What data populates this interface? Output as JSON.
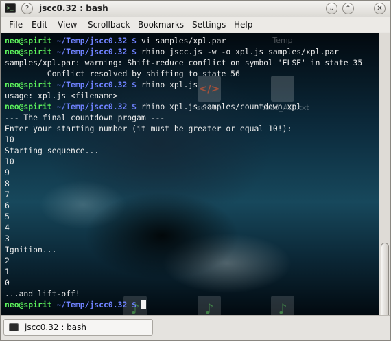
{
  "window": {
    "title": "jscc0.32 : bash",
    "buttons": {
      "help": "?",
      "minimize": "⌄",
      "maximize": "⌃",
      "close": "✕"
    },
    "app_icon": "terminal-icon"
  },
  "menu": [
    "File",
    "Edit",
    "View",
    "Scrollback",
    "Bookmarks",
    "Settings",
    "Help"
  ],
  "desktop_icons": [
    {
      "label": "Temp",
      "icon": "folder-icon"
    },
    {
      "label": "screen",
      "icon": "html-file-icon"
    },
    {
      "label": "todo_ALL.txt",
      "icon": "text-file-icon"
    }
  ],
  "prompt": {
    "user": "neo@spirit",
    "path": "~/Temp/jscc0.32",
    "symbol": "$"
  },
  "terminal_lines": [
    {
      "type": "prompt",
      "cmd": " vi samples/xpl.par"
    },
    {
      "type": "prompt",
      "cmd": " rhino jscc.js -w -o xpl.js samples/xpl.par"
    },
    {
      "type": "out",
      "text": "samples/xpl.par: warning: Shift-reduce conflict on symbol 'ELSE' in state 35"
    },
    {
      "type": "out",
      "text": "         Conflict resolved by shifting to state 56"
    },
    {
      "type": "prompt",
      "cmd": " rhino xpl.js"
    },
    {
      "type": "out",
      "text": "usage: xpl.js <filename>"
    },
    {
      "type": "prompt",
      "cmd": " rhino xpl.js samples/countdown.xpl"
    },
    {
      "type": "out",
      "text": "--- The final countdown progam ---"
    },
    {
      "type": "out",
      "text": "Enter your starting number (it must be greater or equal 10!):"
    },
    {
      "type": "out",
      "text": "10"
    },
    {
      "type": "out",
      "text": "Starting sequence..."
    },
    {
      "type": "out",
      "text": "10"
    },
    {
      "type": "out",
      "text": "9"
    },
    {
      "type": "out",
      "text": "8"
    },
    {
      "type": "out",
      "text": "7"
    },
    {
      "type": "out",
      "text": "6"
    },
    {
      "type": "out",
      "text": "5"
    },
    {
      "type": "out",
      "text": "4"
    },
    {
      "type": "out",
      "text": "3"
    },
    {
      "type": "out",
      "text": "Ignition..."
    },
    {
      "type": "out",
      "text": "2"
    },
    {
      "type": "out",
      "text": "1"
    },
    {
      "type": "out",
      "text": "0"
    },
    {
      "type": "out",
      "text": "...and lift-off!"
    },
    {
      "type": "active",
      "cmd": " "
    }
  ],
  "tab": {
    "label": "jscc0.32 : bash",
    "icon": "terminal-icon"
  },
  "colors": {
    "user": "#5cf05c",
    "path": "#6f82ff",
    "text": "#ececec"
  }
}
